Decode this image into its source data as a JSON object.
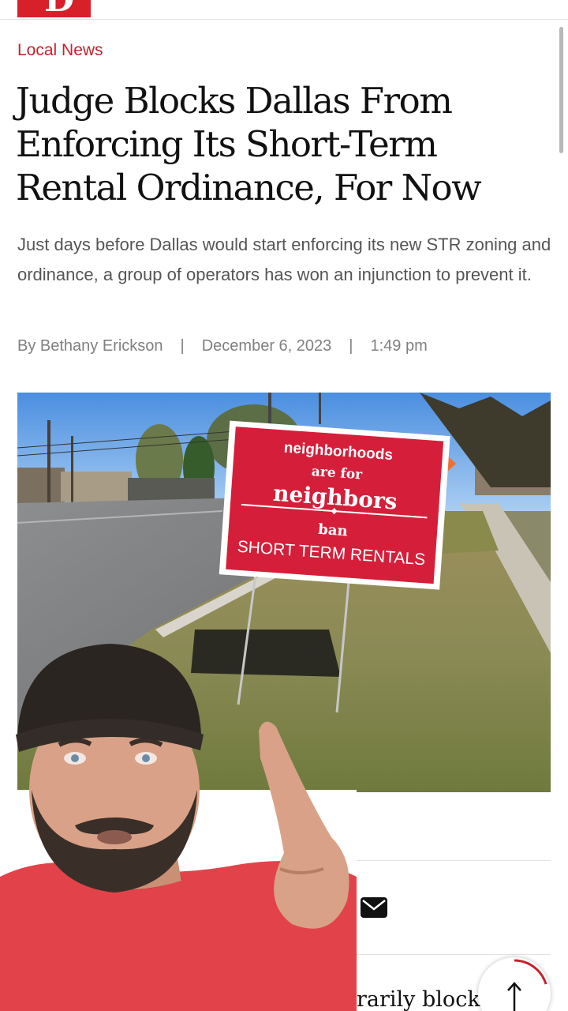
{
  "header": {
    "logo_letter": "D"
  },
  "article": {
    "category": "Local News",
    "headline": "Judge Blocks Dallas From Enforcing Its Short-Term Rental Ordinance, For Now",
    "dek": "Just days before Dallas would start enforcing its new STR zoning and ordinance, a group of operators has won an injunction to prevent it.",
    "byline": {
      "author": "By Bethany Erickson",
      "separator": "|",
      "date": "December 6, 2023",
      "time": "1:49 pm"
    },
    "image": {
      "sign_line1": "neighborhoods",
      "sign_line2": "are for",
      "sign_line3": "neighbors",
      "sign_line4": "ban",
      "sign_line5": "SHORT TERM RENTALS"
    },
    "body_snippet": "rarily block"
  },
  "share": {
    "icons": [
      "link-icon",
      "email-icon"
    ]
  },
  "scroll_top": {
    "icon": "arrow-up-icon"
  },
  "colors": {
    "accent": "#c8202c",
    "sign_red": "#d51f3a",
    "text": "#111111",
    "muted": "#555555"
  }
}
